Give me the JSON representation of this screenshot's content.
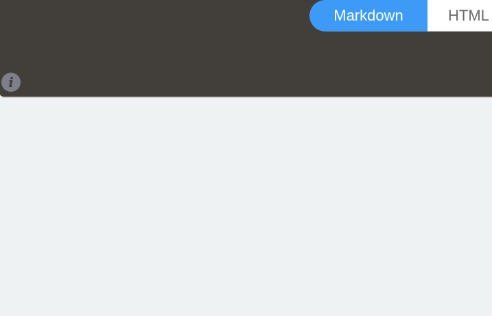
{
  "mode_toggle": {
    "options": [
      {
        "label": "Markdown",
        "active": true
      },
      {
        "label": "HTML",
        "active": false
      }
    ],
    "active_color": "#3d9bf7"
  },
  "info_button": {
    "icon": "info-icon",
    "glyph": "i"
  },
  "colors": {
    "panel_background": "#423e39",
    "page_background": "#eff2f3"
  }
}
